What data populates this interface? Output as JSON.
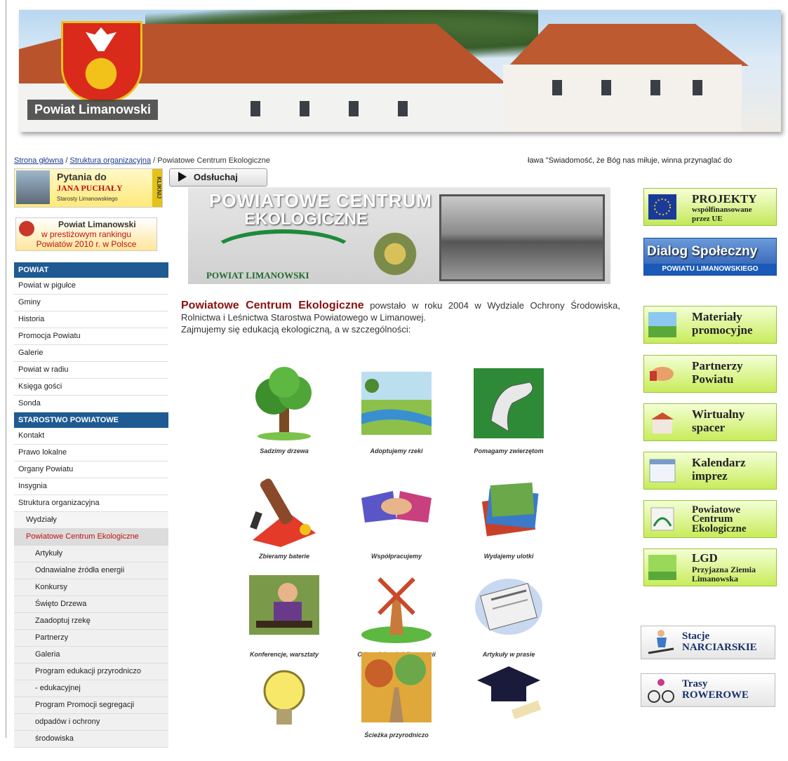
{
  "banner": {
    "title": "Powiat Limanowski"
  },
  "breadcrumb": {
    "home": "Strona główna",
    "sep1": " / ",
    "structure": "Struktura organizacyjna",
    "sep2": " / ",
    "current": "Powiatowe Centrum Ekologiczne"
  },
  "ticker": "ława     \"Świadomość, że Bóg nas miłuje, winna przynaglać do",
  "left": {
    "promo_questions": {
      "line1": "Pytania do",
      "line2": "JANA PUCHAŁY",
      "line3": "Starosty Limanowskiego",
      "kliknij": "KLIKNIJ"
    },
    "promo_ranking": {
      "line1": "Powiat Limanowski",
      "line2": "w prestiżowym rankingu",
      "line3": "Powiatów 2010 r. w Polsce"
    },
    "sections": [
      {
        "head": "POWIAT",
        "items": [
          "Powiat w pigułce",
          "Gminy",
          "Historia",
          "Promocja Powiatu",
          "Galerie",
          "Powiat w radiu",
          "Księga gości",
          "Sonda"
        ]
      },
      {
        "head": "STAROSTWO POWIATOWE",
        "items": [
          "Kontakt",
          "Prawo lokalne",
          "Organy Powiatu",
          "Insygnia",
          "Struktura organizacyjna"
        ]
      }
    ],
    "sub": {
      "wydzialy": "Wydziały",
      "active": "Powiatowe Centrum Ekologiczne"
    },
    "sub3": [
      "Artykuły",
      "Odnawialne źródła energii",
      "Konkursy",
      "Święto Drzewa",
      "Zaadoptuj rzekę",
      "Partnerzy",
      "Galeria",
      "Program edukacji przyrodniczo",
      "- edukacyjnej",
      "Program Promocji segregacji",
      "odpadów i ochrony",
      "środowiska"
    ]
  },
  "center": {
    "listen": "Odsłuchaj",
    "pce_banner": {
      "line1": "POWIATOWE CENTRUM",
      "line2": "EKOLOGICZNE",
      "line3": "POWIAT LIMANOWSKI"
    },
    "intro_lead": "Powiatowe Centrum Ekologiczne",
    "intro_rest": " powstało w roku 2004 w Wydziale Ochrony Środowiska, Rolnictwa i Leśnictwa Starostwa Powiatowego w Limanowej.",
    "intro_line2": "Zajmujemy się edukacją ekologiczną, a w szczególności:",
    "tiles": [
      {
        "caption": "Sadzimy drzewa",
        "icon": "tree-icon"
      },
      {
        "caption": "Adoptujemy rzeki",
        "icon": "river-icon"
      },
      {
        "caption": "Pomagamy zwierzętom",
        "icon": "horse-icon"
      },
      {
        "caption": "Zbieramy baterie",
        "icon": "battery-icon"
      },
      {
        "caption": "Współpracujemy",
        "icon": "handshake-icon"
      },
      {
        "caption": "Wydajemy ulotki",
        "icon": "leaflets-icon"
      },
      {
        "caption": "Konferencje, warsztaty",
        "icon": "conference-icon"
      },
      {
        "caption": "Odnawialne źródła energii",
        "icon": "windmill-icon"
      },
      {
        "caption": "Artykuły w prasie",
        "icon": "newspaper-icon"
      },
      {
        "caption": "",
        "icon": "lightbulb-icon"
      },
      {
        "caption": "Ścieżka przyrodniczo",
        "icon": "path-icon"
      },
      {
        "caption": "",
        "icon": "graduation-cap-icon"
      }
    ]
  },
  "right": {
    "projekty": {
      "line1": "PROJEKTY",
      "line2": "współfinansowane",
      "line3": "przez UE"
    },
    "dialog": {
      "line1": "Dialog Społeczny",
      "line2": "POWIATU LIMANOWSKIEGO"
    },
    "buttons": [
      {
        "line1": "Materiały",
        "line2": "promocyjne"
      },
      {
        "line1": "Partnerzy",
        "line2": "Powiatu"
      },
      {
        "line1": "Wirtualny",
        "line2": "spacer"
      },
      {
        "line1": "Kalendarz",
        "line2": "imprez"
      },
      {
        "line1": "Powiatowe",
        "line2": "Centrum",
        "line3": "Ekologiczne"
      },
      {
        "line1": "LGD",
        "line2": "Przyjazna Ziemia",
        "line3": "Limanowska"
      }
    ],
    "sports": [
      {
        "line1": "Stacje",
        "line2": "NARCIARSKIE"
      },
      {
        "line1": "Trasy",
        "line2": "ROWEROWE"
      }
    ]
  }
}
